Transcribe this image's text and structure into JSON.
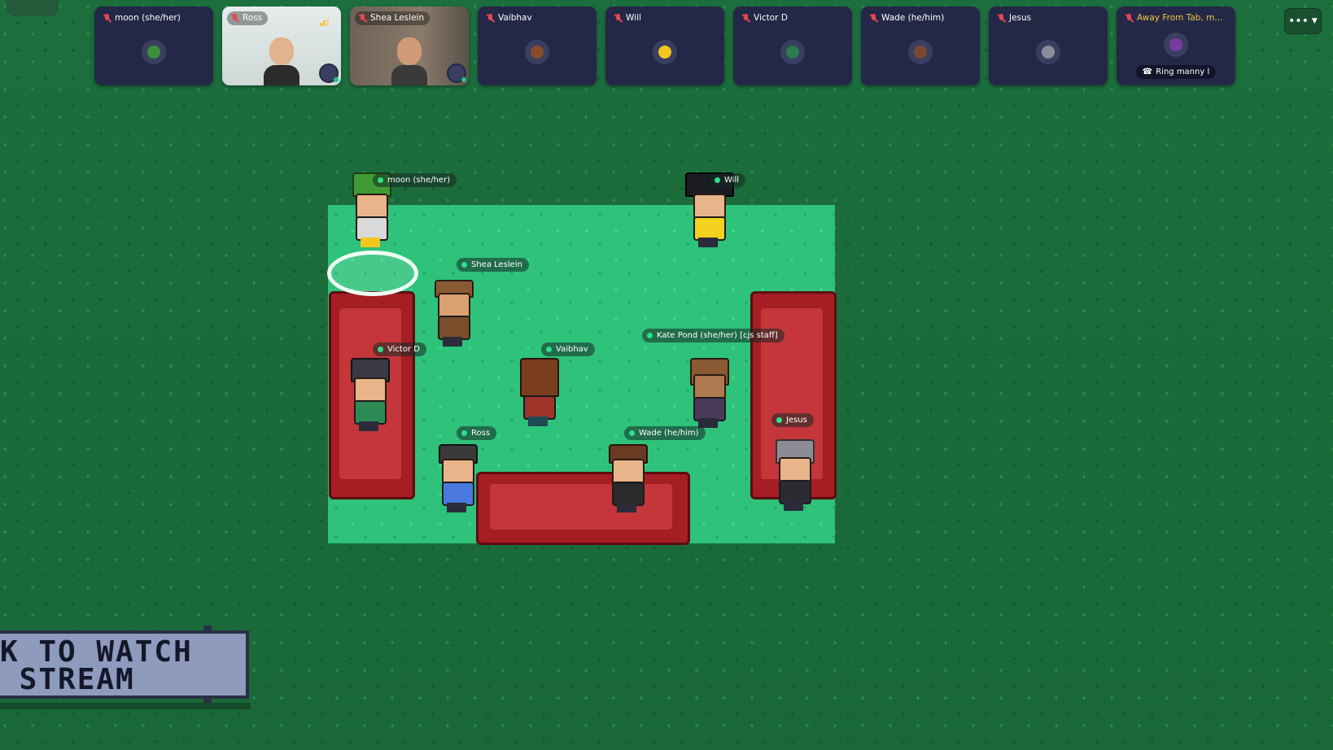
{
  "video_bar": {
    "tiles": [
      {
        "name": "moon (she/her)",
        "muted": true
      },
      {
        "name": "Ross",
        "muted": true,
        "video": true
      },
      {
        "name": "Shea Leslein",
        "muted": true,
        "video": true
      },
      {
        "name": "Vaibhav",
        "muted": true
      },
      {
        "name": "Will",
        "muted": true
      },
      {
        "name": "Victor D",
        "muted": true
      },
      {
        "name": "Wade (he/him)",
        "muted": true
      },
      {
        "name": "Jesus",
        "muted": true
      },
      {
        "name": "Away From Tab, m...",
        "muted": true,
        "status": "Ring manny l"
      }
    ],
    "menu_icon": "more-options-icon"
  },
  "map": {
    "players": [
      {
        "name": "moon (she/her)"
      },
      {
        "name": "Will"
      },
      {
        "name": "Shea Leslein"
      },
      {
        "name": "Victor D"
      },
      {
        "name": "Vaibhav"
      },
      {
        "name": "Kate Pond (she/her) [cjs staff]"
      },
      {
        "name": "Ross"
      },
      {
        "name": "Wade (he/him)"
      },
      {
        "name": "Jesus"
      }
    ],
    "sign_text": "K TO WATCH\n STREAM"
  },
  "colors": {
    "grass": "#1b6b3a",
    "room_floor": "#2ec27a",
    "sofa": "#a51e24",
    "tile_bg": "#232847",
    "online_dot": "#2fe08a",
    "mute_red": "#e5484d"
  }
}
